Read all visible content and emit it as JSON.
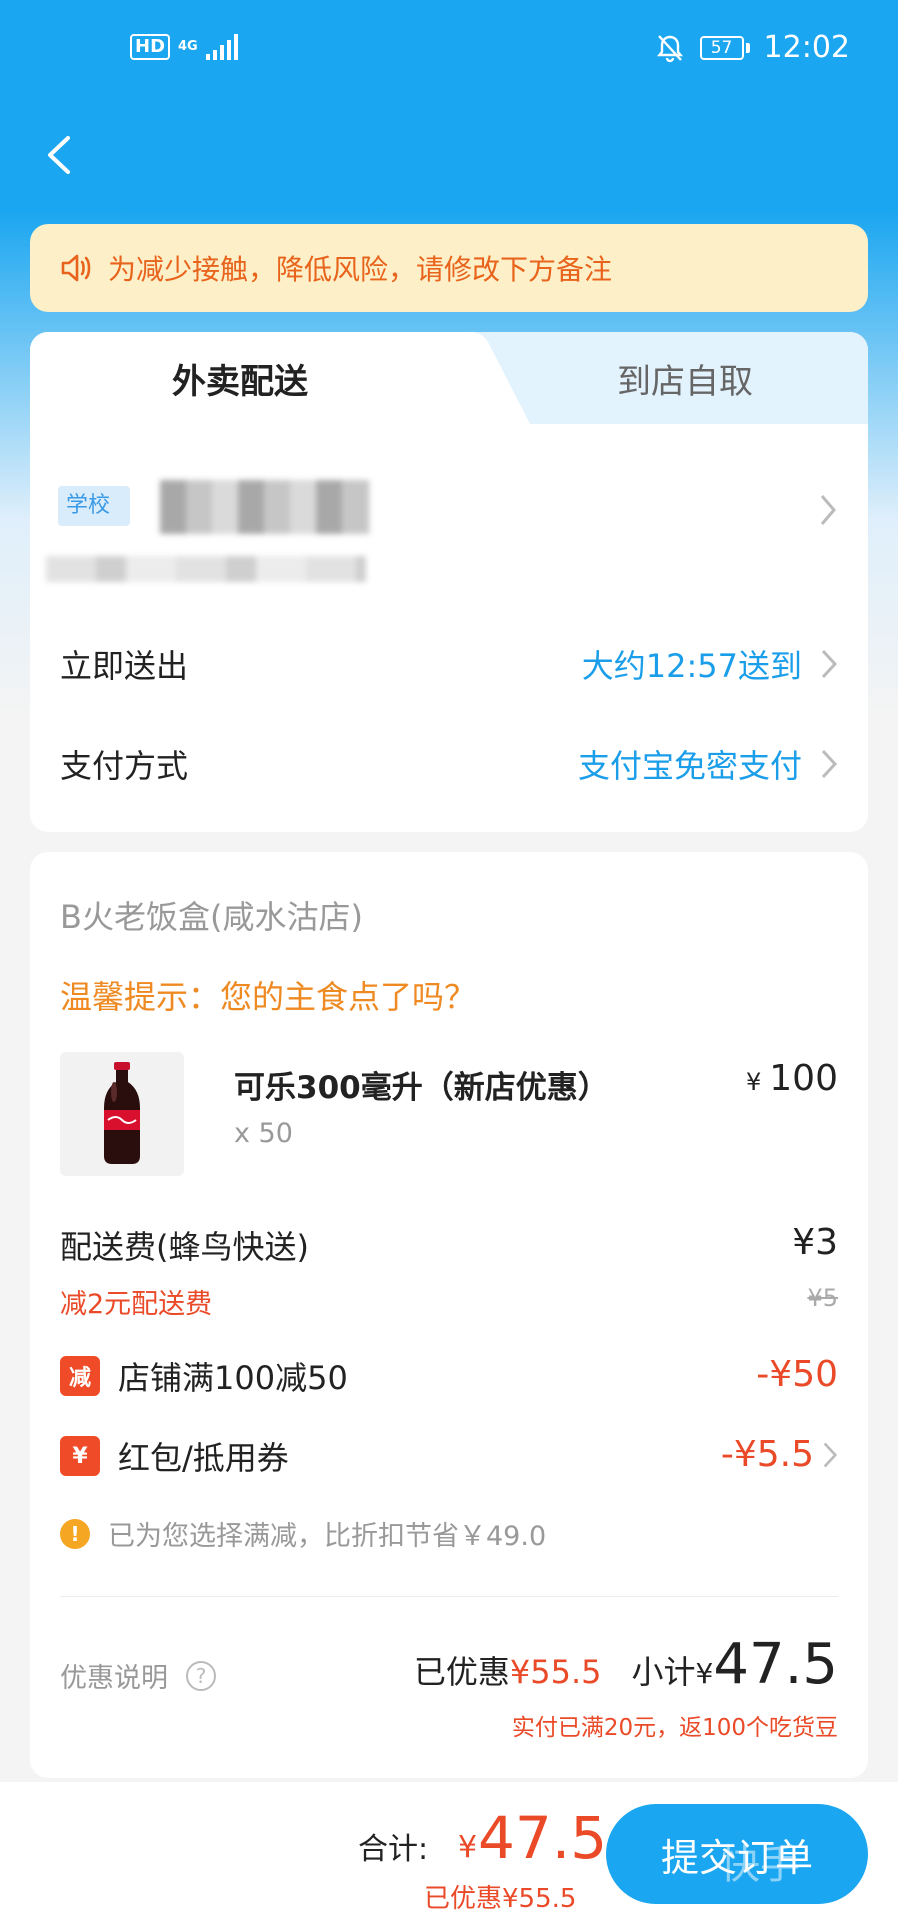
{
  "status_bar": {
    "hd": "HD",
    "network": "4G",
    "battery": "57",
    "time": "12:02"
  },
  "notice": {
    "text": "为减少接触，降低风险，请修改下方备注"
  },
  "tabs": {
    "delivery": "外卖配送",
    "pickup": "到店自取"
  },
  "address": {
    "tag": "学校"
  },
  "delivery_time": {
    "label": "立即送出",
    "value": "大约12:57送到"
  },
  "payment": {
    "label": "支付方式",
    "value": "支付宝免密支付"
  },
  "order": {
    "shop_name": "B火老饭盒(咸水沽店)",
    "tip": "温馨提示：您的主食点了吗？",
    "product": {
      "name": "可乐300毫升（新店优惠）",
      "qty": "x 50",
      "currency": "¥",
      "price": "100"
    },
    "delivery_fee": {
      "label": "配送费(蜂鸟快送)",
      "value": "¥3",
      "discount": "减2元配送费",
      "original": "¥5"
    },
    "promos": [
      {
        "badge": "减",
        "label": "店铺满100减50",
        "value": "-¥50"
      },
      {
        "badge": "¥",
        "label": "红包/抵用券",
        "value": "-¥5.5"
      }
    ],
    "saving_note": "已为您选择满减，比折扣节省￥49.0",
    "promo_info": "优惠说明",
    "saved_label": "已优惠",
    "saved_value": "¥55.5",
    "subtotal_label": "小计",
    "subtotal_currency": "¥",
    "subtotal_value": "47.5",
    "rebate": "实付已满20元，返100个吃货豆"
  },
  "bottom_bar": {
    "total_label": "合计:",
    "total_currency": "¥",
    "total_value": "47.5",
    "total_saved": "已优惠¥55.5",
    "submit": "提交订单",
    "watermark": "快手"
  },
  "colors": {
    "brand_blue": "#1aa6f0",
    "discount_red": "#ea4a28",
    "tip_orange": "#ef8a22",
    "notice_bg": "#fdefc7"
  }
}
